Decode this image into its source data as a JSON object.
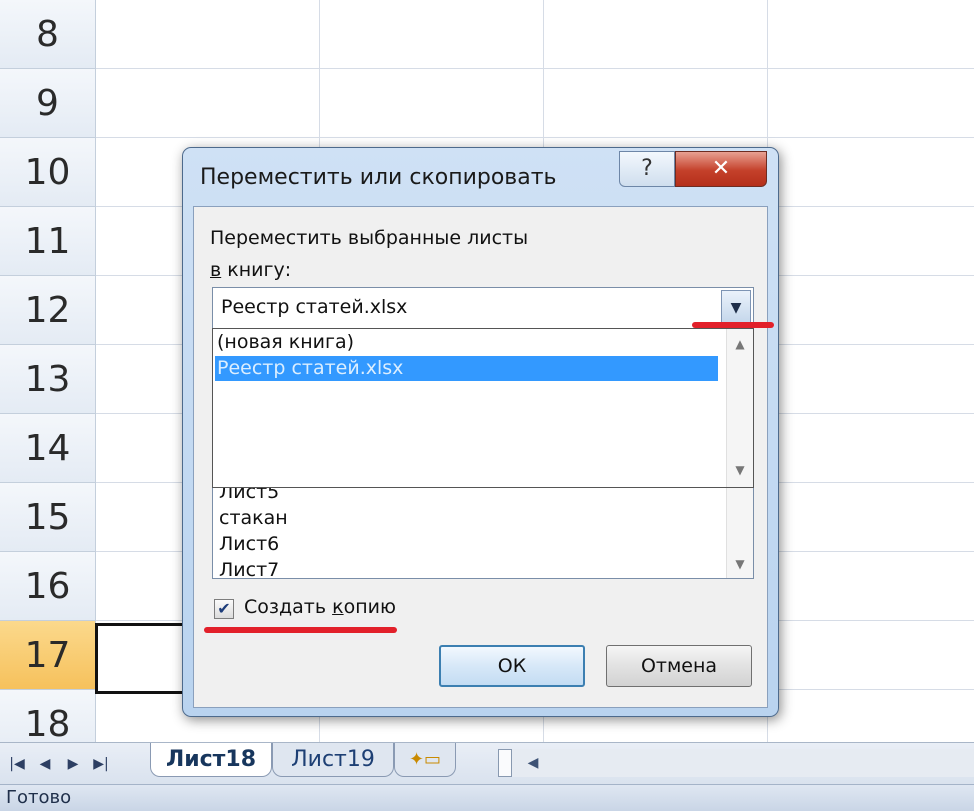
{
  "spreadsheet": {
    "rows": [
      "8",
      "9",
      "10",
      "11",
      "12",
      "13",
      "14",
      "15",
      "16",
      "17",
      "18"
    ],
    "active_row": "17"
  },
  "dialog": {
    "title": "Переместить или скопировать",
    "help_glyph": "?",
    "close_glyph": "✕",
    "move_label": "Переместить выбранные листы",
    "book_label_accel": "в",
    "book_label_rest": " книгу:",
    "book_combo": {
      "value": "Реестр статей.xlsx",
      "options": [
        "(новая книга)",
        "Реестр статей.xlsx"
      ],
      "selected": "Реестр статей.xlsx"
    },
    "sheet_list_visible": [
      "Лист5",
      "стакан",
      "Лист6",
      "Лист7"
    ],
    "copy_checkbox": {
      "checked": true,
      "label_pre": "Создать ",
      "label_accel": "к",
      "label_post": "опию"
    },
    "ok_label": "ОК",
    "cancel_label": "Отмена"
  },
  "sheet_tabs": {
    "tabs": [
      {
        "label": "Лист18",
        "active": true
      },
      {
        "label": "Лист19",
        "active": false
      }
    ],
    "new_sheet_icon": "insert-sheet-icon"
  },
  "status_bar": {
    "text": "Готово"
  },
  "colors": {
    "selection_blue": "#3399ff",
    "active_row_header": "#f6c15c",
    "annotation_red": "#e2202a"
  }
}
